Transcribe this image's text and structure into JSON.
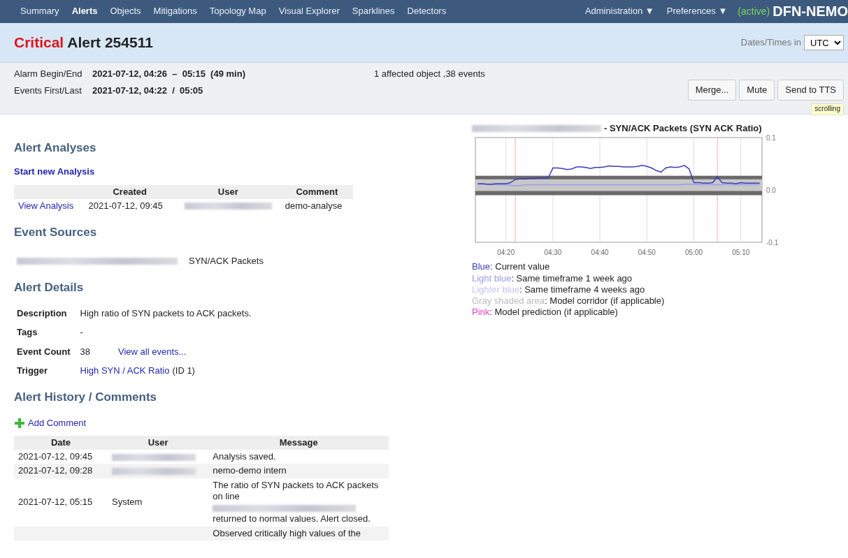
{
  "nav": {
    "items": [
      {
        "label": "Summary",
        "selected": false
      },
      {
        "label": "Alerts",
        "selected": true
      },
      {
        "label": "Objects",
        "selected": false
      },
      {
        "label": "Mitigations",
        "selected": false
      },
      {
        "label": "Topology Map",
        "selected": false
      },
      {
        "label": "Visual Explorer",
        "selected": false
      },
      {
        "label": "Sparklines",
        "selected": false
      },
      {
        "label": "Detectors",
        "selected": false
      }
    ],
    "right": [
      "Administration ▼",
      "Preferences ▼"
    ],
    "status": "(active)",
    "brand": "DFN-NEMO"
  },
  "title": {
    "severity": "Critical",
    "text": "Alert 254511",
    "tz_label": "Dates/Times in",
    "tz_value": "UTC"
  },
  "info": {
    "rows": [
      {
        "label": "Alarm Begin/End",
        "value": "2021-07-12, 04:26  –  05:15  (49 min)"
      },
      {
        "label": "Events First/Last",
        "value": "2021-07-12, 04:22  /  05:05"
      }
    ],
    "summary": "1 affected object ,38 events",
    "buttons": [
      "Merge...",
      "Mute",
      "Send to TTS"
    ],
    "tooltip": "scrolling"
  },
  "analyses": {
    "heading": "Alert Analyses",
    "start_link": "Start new Analysis",
    "columns": [
      "Created",
      "User",
      "Comment"
    ],
    "rows": [
      {
        "link": "View Analysis",
        "created": "2021-07-12, 09:45",
        "user": {
          "redacted": true
        },
        "comment": "demo-analyse"
      }
    ]
  },
  "event_sources": {
    "heading": "Event Sources",
    "items": [
      {
        "object": {
          "redacted": true
        },
        "name": "SYN/ACK Packets"
      }
    ]
  },
  "details": {
    "heading": "Alert Details",
    "rows": [
      {
        "kind": "text",
        "label": "Description",
        "value": "High ratio of SYN packets to ACK packets."
      },
      {
        "kind": "text",
        "label": "Tags",
        "value": "-"
      },
      {
        "kind": "count",
        "label": "Event Count",
        "value": "38",
        "link": "View all events..."
      },
      {
        "kind": "trigger",
        "label": "Trigger",
        "link": "High SYN / ACK Ratio",
        "value": "(ID 1)"
      }
    ]
  },
  "history": {
    "heading": "Alert History / Comments",
    "add_link": "Add Comment",
    "columns": [
      "Date",
      "User",
      "Message"
    ],
    "rows": [
      {
        "date": "2021-07-12, 09:45",
        "user": {
          "redacted": true
        },
        "message": [
          "Analysis saved."
        ]
      },
      {
        "date": "2021-07-12, 09:28",
        "user": {
          "redacted": true
        },
        "message": [
          "nemo-demo intern"
        ]
      },
      {
        "date": "2021-07-12, 05:15",
        "user": {
          "text": "System"
        },
        "message": [
          "The ratio of SYN packets to ACK packets on line",
          {
            "redacted": true
          },
          "returned to normal values. Alert closed."
        ]
      },
      {
        "message": [
          "Observed critically high values of the"
        ]
      }
    ]
  },
  "chart": {
    "title_object": {
      "redacted": true
    },
    "title": "- SYN/ACK Packets (SYN ACK Ratio)",
    "chart_data": {
      "type": "line",
      "categories": [
        null,
        null,
        null,
        null,
        null,
        null,
        "04:20",
        null,
        null,
        null,
        null,
        null,
        null,
        null,
        null,
        null,
        "04:30",
        null,
        null,
        null,
        null,
        null,
        null,
        null,
        null,
        null,
        "04:40",
        null,
        null,
        null,
        null,
        null,
        null,
        null,
        null,
        null,
        "04:50",
        null,
        null,
        null,
        null,
        null,
        null,
        null,
        null,
        null,
        "05:00",
        null,
        null,
        null,
        null,
        null,
        null,
        null,
        null,
        null,
        "05:10",
        null,
        null,
        null,
        null
      ],
      "series": [
        {
          "color": "#3a3ab8",
          "values": [
            0.012,
            0.012,
            0.011,
            0.011,
            0.012,
            0.012,
            0.012,
            0.014,
            0.02,
            0.021,
            0.021,
            0.022,
            0.022,
            0.023,
            0.023,
            0.023,
            0.042,
            0.042,
            0.041,
            0.039,
            0.04,
            0.044,
            0.044,
            0.043,
            0.041,
            0.043,
            0.043,
            0.044,
            0.046,
            0.045,
            0.045,
            0.044,
            0.044,
            0.044,
            0.045,
            0.047,
            0.045,
            0.042,
            0.037,
            0.034,
            0.042,
            0.044,
            0.043,
            0.044,
            0.047,
            0.04,
            0.014,
            0.014,
            0.013,
            0.013,
            0.014,
            0.025,
            0.014,
            0.013,
            0.013,
            0.012,
            0.014,
            0.013,
            0.013,
            0.013,
            0.013
          ]
        },
        {
          "color": "#9a9aee",
          "values": [
            0.011,
            0.011,
            0.011,
            0.01,
            0.01,
            0.01,
            0.01,
            0.009,
            0.008,
            0.008,
            0.01,
            0.01,
            0.01,
            0.01,
            0.01,
            0.01,
            0.01,
            0.01,
            0.01,
            0.01,
            0.01,
            0.01,
            0.01,
            0.01,
            0.01,
            0.01,
            0.01,
            0.01,
            0.01,
            0.01,
            0.01,
            0.01,
            0.01,
            0.01,
            0.01,
            0.01,
            0.01,
            0.01,
            0.01,
            0.01,
            0.01,
            0.01,
            0.01,
            0.01,
            0.011,
            0.011,
            0.011,
            0.01,
            0.01,
            0.01,
            0.01,
            0.01,
            0.01,
            0.01,
            0.01,
            0.01,
            0.01,
            0.01,
            0.01,
            0.01,
            0.01
          ]
        }
      ],
      "ylim": [
        -0.1,
        0.1
      ],
      "yticks": [
        {
          "value": 0.1,
          "label": "0.1"
        },
        {
          "value": 0,
          "label": "0.0"
        },
        {
          "value": -0.1,
          "label": "-0.1"
        }
      ],
      "grid": true,
      "annotations": [
        {
          "x": "04:22"
        },
        {
          "x": "05:05"
        }
      ]
    },
    "legend": [
      {
        "term": "Blue",
        "text": ": Current value",
        "color": "#3a3ab8"
      },
      {
        "term": "Light blue",
        "text": ": Same timeframe 1 week ago",
        "color": "#9a9aee"
      },
      {
        "term": "Lighter blue",
        "text": ": Same timeframe 4 weeks ago",
        "color": "#c4c4f2"
      },
      {
        "term": "Gray shaded area",
        "text": ": Model corridor (if applicable)",
        "color": "#bbbbbb"
      },
      {
        "term": "Pink",
        "text": ": Model prediction (if applicable)",
        "color": "#e040d0"
      }
    ]
  }
}
